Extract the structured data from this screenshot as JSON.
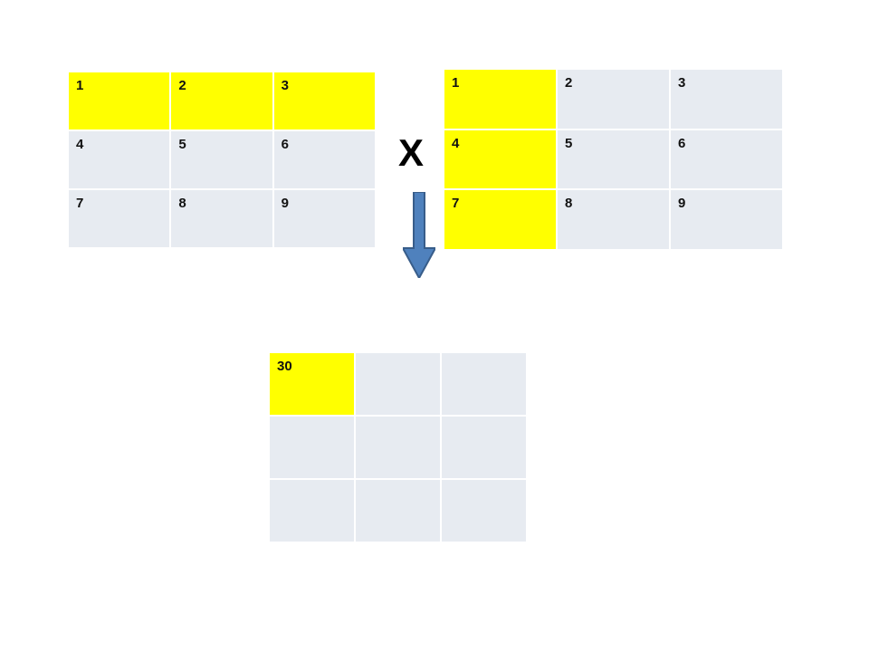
{
  "operator": "X",
  "matrixA": {
    "cells": [
      {
        "value": "1",
        "highlight": true
      },
      {
        "value": "2",
        "highlight": true
      },
      {
        "value": "3",
        "highlight": true
      },
      {
        "value": "4",
        "highlight": false
      },
      {
        "value": "5",
        "highlight": false
      },
      {
        "value": "6",
        "highlight": false
      },
      {
        "value": "7",
        "highlight": false
      },
      {
        "value": "8",
        "highlight": false
      },
      {
        "value": "9",
        "highlight": false
      }
    ]
  },
  "matrixB": {
    "cells": [
      {
        "value": "1",
        "highlight": true
      },
      {
        "value": "2",
        "highlight": false
      },
      {
        "value": "3",
        "highlight": false
      },
      {
        "value": "4",
        "highlight": true
      },
      {
        "value": "5",
        "highlight": false
      },
      {
        "value": "6",
        "highlight": false
      },
      {
        "value": "7",
        "highlight": true
      },
      {
        "value": "8",
        "highlight": false
      },
      {
        "value": "9",
        "highlight": false
      }
    ]
  },
  "matrixC": {
    "cells": [
      {
        "value": "30",
        "highlight": true
      },
      {
        "value": "",
        "highlight": false
      },
      {
        "value": "",
        "highlight": false
      },
      {
        "value": "",
        "highlight": false
      },
      {
        "value": "",
        "highlight": false
      },
      {
        "value": "",
        "highlight": false
      },
      {
        "value": "",
        "highlight": false
      },
      {
        "value": "",
        "highlight": false
      },
      {
        "value": "",
        "highlight": false
      }
    ]
  },
  "colors": {
    "highlight": "#ffff00",
    "cell": "#e7ebf1",
    "arrowFill": "#4f81bd",
    "arrowStroke": "#385d8a"
  }
}
